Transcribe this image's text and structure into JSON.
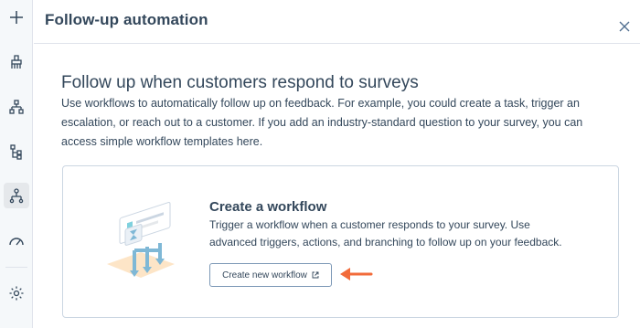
{
  "rail": {
    "items": [
      {
        "name": "add-icon"
      },
      {
        "name": "brush-icon"
      },
      {
        "name": "sitemap-icon"
      },
      {
        "name": "hierarchy-icon"
      },
      {
        "name": "workflow-icon",
        "active": true
      },
      {
        "name": "gauge-icon"
      },
      {
        "name": "settings-gear-icon"
      }
    ]
  },
  "panel": {
    "title": "Follow-up automation"
  },
  "intro": {
    "heading": "Follow up when customers respond to surveys",
    "text": "Use workflows to automatically follow up on feedback. For example, you could create a task, trigger an escalation, or reach out to a customer. If you add an industry-standard question to your survey, you can access simple workflow templates here."
  },
  "card": {
    "title": "Create a workflow",
    "text": "Trigger a workflow when a customer responds to your survey. Use advanced triggers, actions, and branching to follow up on your feedback.",
    "button_label": "Create new workflow",
    "button_icon": "external-link-icon"
  },
  "colors": {
    "accent_arrow": "#f26b3a",
    "text": "#33475b",
    "border": "#cbd6e2",
    "rail_bg": "#f5f8fa"
  }
}
